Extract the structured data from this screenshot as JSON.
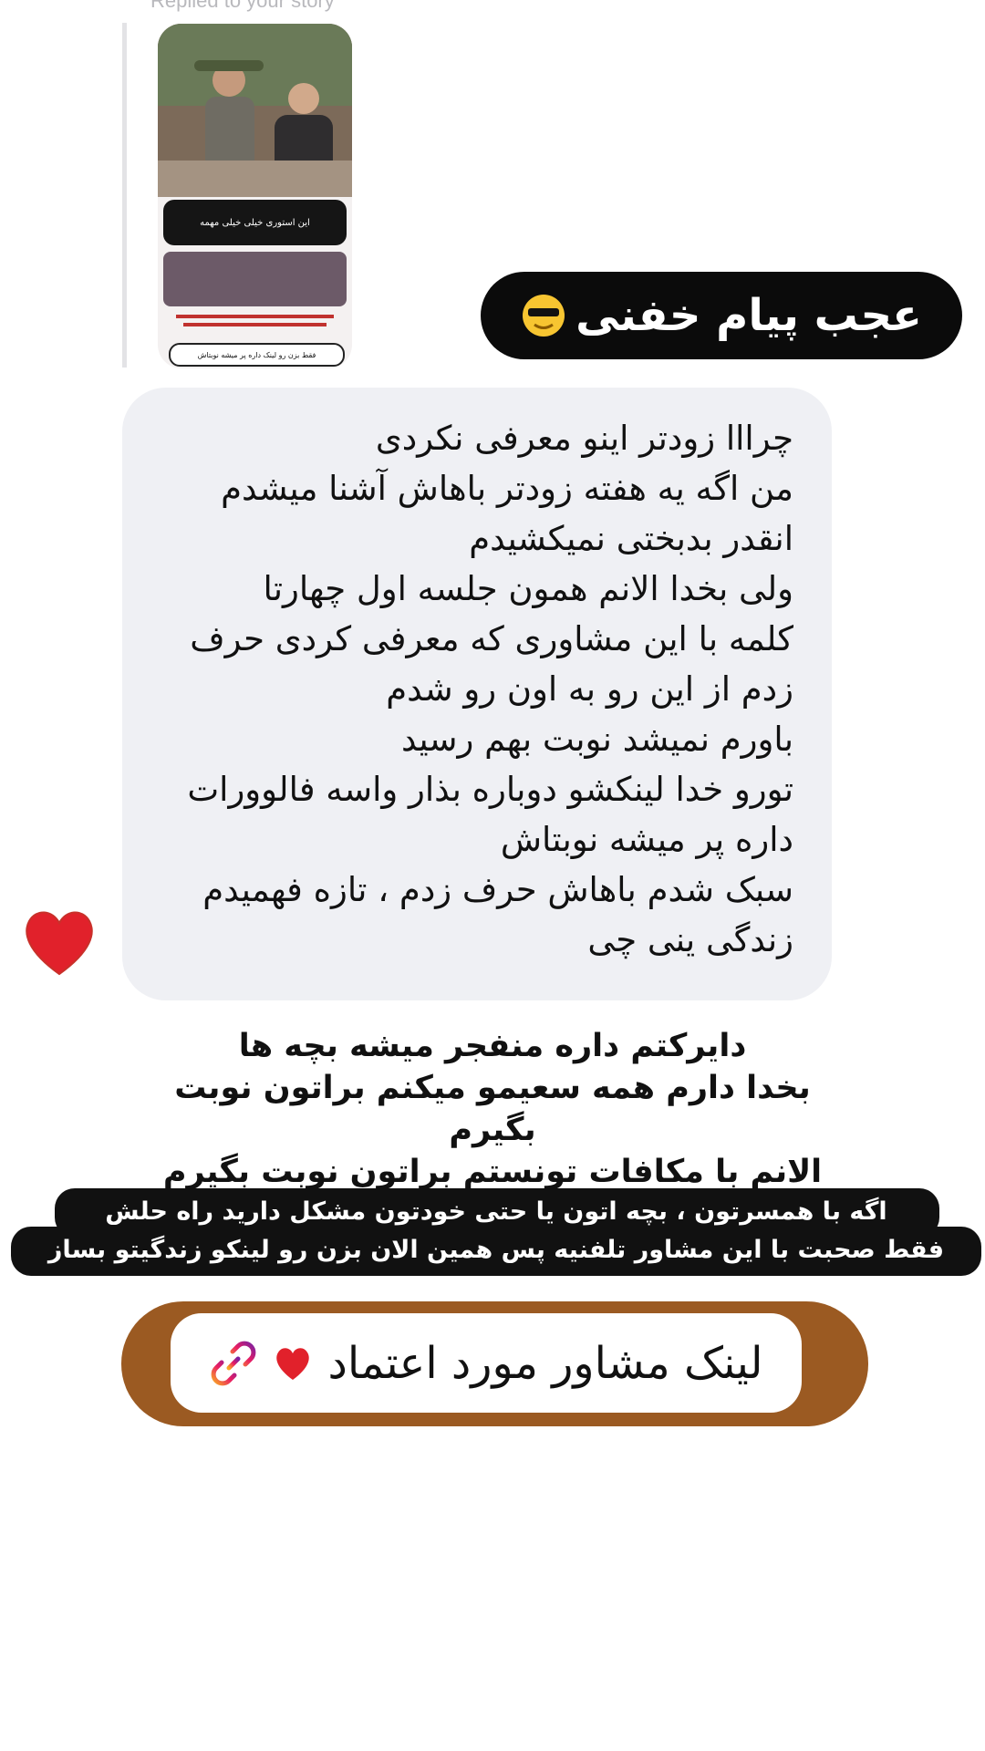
{
  "story_reply": {
    "label": "Replied to your story",
    "thumbnail_caption": "این استوری خیلی خیلی مهمه",
    "thumbnail_link": "فقط بزن رو لینک داره پر میشه نوبتاش"
  },
  "bubbles": {
    "black_title": "عجب پیام خفنی",
    "grey_message": "چرااا زودتر اینو معرفی نکردی\nمن اگه یه هفته زودتر باهاش آشنا میشدم\nانقدر بدبختی نمیکشیدم\nولی بخدا الانم همون جلسه اول چهارتا\nکلمه با این مشاوری که معرفی کردی حرف\nزدم از این رو به اون رو شدم\nباورم نمیشد نوبت بهم رسید\nتورو خدا لینکشو دوباره بذار واسه فالوورات\nداره پر میشه نوبتاش\nسبک شدم باهاش حرف زدم ، تازه فهمیدم\nزندگی ینی چی"
  },
  "mid_text": "دایرکتم داره منفجر میشه بچه ها\nبخدا دارم همه سعیمو میکنم براتون نوبت بگیرم\nالانم با مکافات تونستم براتون نوبت بگیرم",
  "caption": {
    "line1": "اگه با همسرتون ، بچه اتون یا حتی خودتون مشکل دارید راه حلش",
    "line2": "فقط صحبت با این مشاور تلفنیه پس همین الان بزن رو لینکو زندگیتو بساز"
  },
  "link_sticker": {
    "label": "لینک مشاور مورد اعتماد",
    "icon": "link-icon"
  },
  "colors": {
    "grey_bubble": "#eff0f4",
    "black_bubble": "#0b0b0b",
    "sticker_frame": "#9b5a22",
    "heart": "#e1212b"
  }
}
